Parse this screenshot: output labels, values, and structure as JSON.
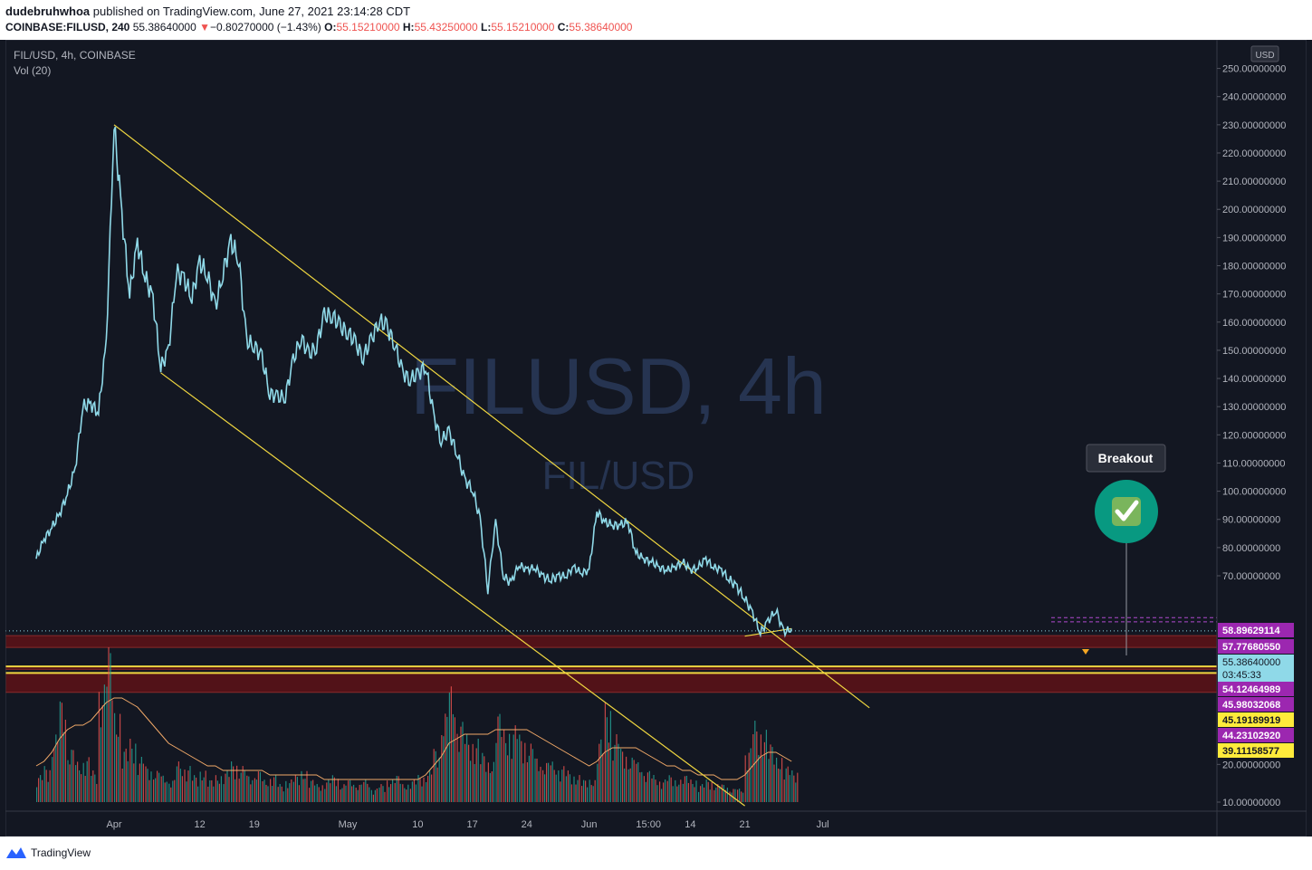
{
  "header": {
    "author": "dudebruhwhoa",
    "published_text": "published on TradingView.com, June 27, 2021 23:14:28 CDT",
    "symbol_full": "COINBASE:FILUSD, 240",
    "last_price": "55.38640000",
    "change_arrow": "▼",
    "change": "−0.80270000 (−1.43%)",
    "open_label": "O:",
    "open": "55.15210000",
    "high_label": "H:",
    "high": "55.43250000",
    "low_label": "L:",
    "low": "55.15210000",
    "close_label": "C:",
    "close": "55.38640000"
  },
  "chart_legend": {
    "symbol": "FIL/USD, 4h, COINBASE",
    "volume": "Vol (20)"
  },
  "watermark": {
    "main": "FILUSD, 4h",
    "sub": "FIL/USD"
  },
  "currency_badge": "USD",
  "annotation": {
    "label": "Breakout",
    "icon": "check-mark-icon"
  },
  "colors": {
    "background": "#131722",
    "price_line": "#8fd9e8",
    "trendline": "#f0d740",
    "resistance_zone": "#5a1217",
    "vol_up": "#26a69a",
    "vol_down": "#ef5350",
    "vol_ma": "#f0a868",
    "axis_text": "#b2b5be",
    "magenta_label": "#9c27b0",
    "yellow_label": "#ffeb3b",
    "badge_green": "#089981"
  },
  "chart_data": {
    "type": "line",
    "title": "",
    "xlabel": "",
    "ylabel": "",
    "ylim": [
      5,
      255
    ],
    "x_ticks": [
      {
        "label": "Apr",
        "date": "2021-04-01"
      },
      {
        "label": "12",
        "date": "2021-04-12"
      },
      {
        "label": "19",
        "date": "2021-04-19"
      },
      {
        "label": "May",
        "date": "2021-05-01"
      },
      {
        "label": "10",
        "date": "2021-05-10"
      },
      {
        "label": "17",
        "date": "2021-05-17"
      },
      {
        "label": "24",
        "date": "2021-05-24"
      },
      {
        "label": "Jun",
        "date": "2021-06-01"
      },
      {
        "label": "15:00",
        "date": "2021-06-08T15:00"
      },
      {
        "label": "14",
        "date": "2021-06-14"
      },
      {
        "label": "21",
        "date": "2021-06-21"
      },
      {
        "label": "Jul",
        "date": "2021-07-01"
      }
    ],
    "y_ticks": [
      {
        "value": 250,
        "label": "250.00000000"
      },
      {
        "value": 240,
        "label": "240.00000000"
      },
      {
        "value": 230,
        "label": "230.00000000"
      },
      {
        "value": 220,
        "label": "220.00000000"
      },
      {
        "value": 210,
        "label": "210.00000000"
      },
      {
        "value": 200,
        "label": "200.00000000"
      },
      {
        "value": 190,
        "label": "190.00000000"
      },
      {
        "value": 180,
        "label": "180.00000000"
      },
      {
        "value": 170,
        "label": "170.00000000"
      },
      {
        "value": 160,
        "label": "160.00000000"
      },
      {
        "value": 150,
        "label": "150.00000000"
      },
      {
        "value": 140,
        "label": "140.00000000"
      },
      {
        "value": 130,
        "label": "130.00000000"
      },
      {
        "value": 120,
        "label": "120.00000000"
      },
      {
        "value": 110,
        "label": "110.00000000"
      },
      {
        "value": 100,
        "label": "100.00000000"
      },
      {
        "value": 90,
        "label": "90.00000000"
      },
      {
        "value": 80,
        "label": "80.00000000"
      },
      {
        "value": 70,
        "label": "70.00000000"
      },
      {
        "value": 20,
        "label": "20.00000000"
      },
      {
        "value": 10,
        "label": "10.00000000"
      }
    ],
    "series": [
      {
        "x": [
          "2021-03-22",
          "2021-03-23",
          "2021-03-24",
          "2021-03-25",
          "2021-03-26",
          "2021-03-27",
          "2021-03-28",
          "2021-03-29",
          "2021-03-30",
          "2021-03-31",
          "2021-04-01",
          "2021-04-02",
          "2021-04-03",
          "2021-04-04",
          "2021-04-05",
          "2021-04-06",
          "2021-04-07",
          "2021-04-08",
          "2021-04-09",
          "2021-04-10",
          "2021-04-11",
          "2021-04-12",
          "2021-04-13",
          "2021-04-14",
          "2021-04-15",
          "2021-04-16",
          "2021-04-17",
          "2021-04-18",
          "2021-04-19",
          "2021-04-20",
          "2021-04-21",
          "2021-04-22",
          "2021-04-23",
          "2021-04-24",
          "2021-04-25",
          "2021-04-26",
          "2021-04-27",
          "2021-04-28",
          "2021-04-29",
          "2021-04-30",
          "2021-05-01",
          "2021-05-02",
          "2021-05-03",
          "2021-05-04",
          "2021-05-05",
          "2021-05-06",
          "2021-05-07",
          "2021-05-08",
          "2021-05-09",
          "2021-05-10",
          "2021-05-11",
          "2021-05-12",
          "2021-05-13",
          "2021-05-14",
          "2021-05-15",
          "2021-05-16",
          "2021-05-17",
          "2021-05-18",
          "2021-05-19",
          "2021-05-20",
          "2021-05-21",
          "2021-05-22",
          "2021-05-23",
          "2021-05-24",
          "2021-05-25",
          "2021-05-26",
          "2021-05-27",
          "2021-05-28",
          "2021-05-29",
          "2021-05-30",
          "2021-05-31",
          "2021-06-01",
          "2021-06-02",
          "2021-06-03",
          "2021-06-04",
          "2021-06-05",
          "2021-06-06",
          "2021-06-07",
          "2021-06-08",
          "2021-06-09",
          "2021-06-10",
          "2021-06-11",
          "2021-06-12",
          "2021-06-13",
          "2021-06-14",
          "2021-06-15",
          "2021-06-16",
          "2021-06-17",
          "2021-06-18",
          "2021-06-19",
          "2021-06-20",
          "2021-06-21",
          "2021-06-22",
          "2021-06-23",
          "2021-06-24",
          "2021-06-25",
          "2021-06-26",
          "2021-06-27"
        ],
        "values": [
          76,
          83,
          87,
          92,
          99,
          108,
          130,
          131,
          128,
          153,
          230,
          198,
          170,
          188,
          176,
          168,
          144,
          150,
          178,
          175,
          169,
          181,
          177,
          165,
          178,
          188,
          183,
          153,
          152,
          147,
          135,
          133,
          134,
          146,
          155,
          148,
          152,
          162,
          163,
          158,
          157,
          152,
          148,
          153,
          161,
          158,
          153,
          142,
          140,
          141,
          145,
          127,
          118,
          121,
          114,
          104,
          101,
          90,
          66,
          89,
          70,
          68,
          74,
          72,
          73,
          70,
          69,
          70,
          70,
          73,
          71,
          72,
          93,
          89,
          88,
          88,
          89,
          78,
          76,
          75,
          73,
          72,
          73,
          75,
          72,
          73,
          76,
          73,
          72,
          69,
          67,
          64,
          60,
          55,
          58,
          61,
          55,
          56
        ]
      }
    ],
    "volume": {
      "name": "Vol (20)",
      "values": [
        6,
        8,
        15,
        23,
        12,
        9,
        10,
        7,
        26,
        35,
        20,
        12,
        14,
        10,
        8,
        7,
        6,
        5,
        9,
        8,
        6,
        7,
        5,
        6,
        7,
        9,
        8,
        6,
        7,
        5,
        6,
        4,
        5,
        6,
        7,
        5,
        4,
        5,
        6,
        4,
        5,
        4,
        5,
        3,
        4,
        5,
        6,
        4,
        5,
        6,
        7,
        12,
        20,
        26,
        18,
        15,
        14,
        11,
        9,
        20,
        16,
        17,
        15,
        13,
        10,
        9,
        9,
        8,
        7,
        6,
        5,
        5,
        14,
        22,
        15,
        12,
        10,
        9,
        7,
        6,
        5,
        6,
        5,
        6,
        5,
        4,
        5,
        4,
        4,
        3,
        3,
        12,
        18,
        16,
        13,
        10,
        8,
        7
      ],
      "ma": [
        8,
        9,
        11,
        14,
        16,
        17,
        17,
        18,
        20,
        22,
        23,
        23,
        22,
        21,
        19,
        17,
        15,
        13,
        12,
        11,
        10,
        9,
        8,
        8,
        7,
        7,
        7,
        7,
        7,
        7,
        6,
        6,
        6,
        6,
        6,
        6,
        6,
        5,
        5,
        5,
        5,
        5,
        5,
        5,
        5,
        5,
        5,
        5,
        5,
        5,
        6,
        8,
        10,
        13,
        14,
        15,
        15,
        15,
        15,
        16,
        16,
        16,
        16,
        16,
        15,
        14,
        13,
        12,
        11,
        10,
        9,
        8,
        9,
        11,
        12,
        12,
        12,
        12,
        11,
        10,
        9,
        8,
        8,
        7,
        7,
        6,
        6,
        6,
        5,
        5,
        5,
        6,
        8,
        10,
        11,
        11,
        10,
        9
      ]
    },
    "trendlines": [
      {
        "from": [
          "2021-04-01",
          230
        ],
        "to": [
          "2021-07-07",
          35
        ]
      },
      {
        "from": [
          "2021-04-07",
          142
        ],
        "to": [
          "2021-06-21",
          9
        ]
      },
      {
        "from": [
          "2021-06-21",
          54
        ],
        "to": [
          "2021-06-27",
          56
        ]
      }
    ],
    "zones": [
      {
        "from": 54.12464989,
        "to": 51.0
      },
      {
        "from": 45.98032068,
        "to": 45.19189919
      },
      {
        "from": 44.2310292,
        "to": 39.11158577
      }
    ],
    "price_labels": [
      {
        "value": 58.89629114,
        "label": "58.89629114",
        "color": "magenta"
      },
      {
        "value": 57.7768055,
        "label": "57.77680550",
        "color": "magenta"
      },
      {
        "value": 55.3864,
        "label": "55.38640000",
        "sublabel": "03:45:33",
        "color": "cyan"
      },
      {
        "value": 54.12464989,
        "label": "54.12464989",
        "color": "magenta"
      },
      {
        "value": 45.98032068,
        "label": "45.98032068",
        "color": "magenta"
      },
      {
        "value": 45.19189919,
        "label": "45.19189919",
        "color": "yellow"
      },
      {
        "value": 44.2310292,
        "label": "44.23102920",
        "color": "magenta"
      },
      {
        "value": 39.11158577,
        "label": "39.11158577",
        "color": "yellow"
      }
    ],
    "grid": false,
    "legend": "top-left"
  },
  "footer": {
    "brand": "TradingView"
  }
}
